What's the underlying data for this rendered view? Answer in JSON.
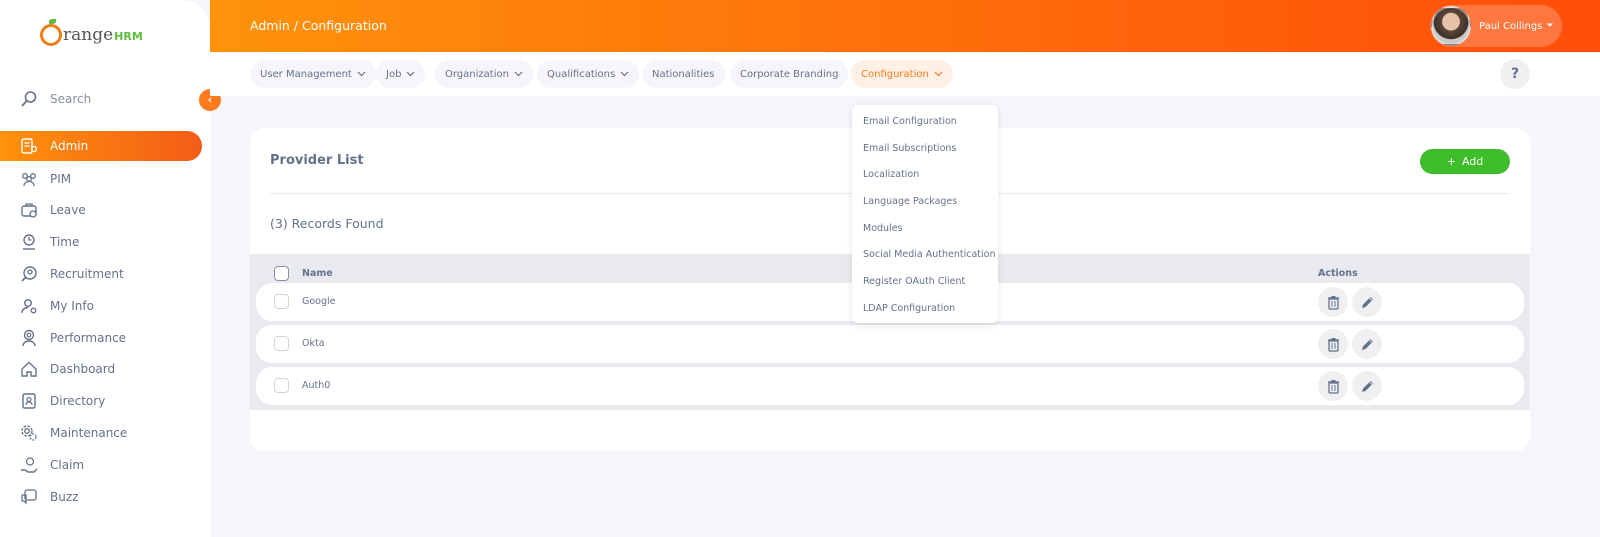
{
  "app": {
    "logo_text": "range",
    "logo_suffix": "HRM"
  },
  "sidebar": {
    "search_label": "Search",
    "collapse_icon": "chevron-left-icon",
    "items": [
      {
        "label": "Admin",
        "icon": "admin-icon",
        "active": true
      },
      {
        "label": "PIM",
        "icon": "pim-icon"
      },
      {
        "label": "Leave",
        "icon": "leave-icon"
      },
      {
        "label": "Time",
        "icon": "time-icon"
      },
      {
        "label": "Recruitment",
        "icon": "recruitment-icon"
      },
      {
        "label": "My Info",
        "icon": "my-info-icon"
      },
      {
        "label": "Performance",
        "icon": "performance-icon"
      },
      {
        "label": "Dashboard",
        "icon": "dashboard-icon"
      },
      {
        "label": "Directory",
        "icon": "directory-icon"
      },
      {
        "label": "Maintenance",
        "icon": "maintenance-icon"
      },
      {
        "label": "Claim",
        "icon": "claim-icon"
      },
      {
        "label": "Buzz",
        "icon": "buzz-icon"
      }
    ]
  },
  "header": {
    "breadcrumb": "Admin / Configuration",
    "user_name": "Paul Collings",
    "caret": "⏷"
  },
  "nav": {
    "tabs": [
      {
        "label": "User Management",
        "has_dropdown": true
      },
      {
        "label": "Job",
        "has_dropdown": true
      },
      {
        "label": "Organization",
        "has_dropdown": true
      },
      {
        "label": "Qualifications",
        "has_dropdown": true
      },
      {
        "label": "Nationalities",
        "has_dropdown": false
      },
      {
        "label": "Corporate Branding",
        "has_dropdown": false
      },
      {
        "label": "Configuration",
        "has_dropdown": true,
        "active": true
      }
    ],
    "help_label": "?"
  },
  "dropdown": {
    "items": [
      "Email Configuration",
      "Email Subscriptions",
      "Localization",
      "Language Packages",
      "Modules",
      "Social Media Authentication",
      "Register OAuth Client",
      "LDAP Configuration"
    ]
  },
  "main": {
    "title": "Provider List",
    "add_label": "Add",
    "add_icon": "plus-icon",
    "records_found": "(3) Records Found",
    "table": {
      "columns": [
        "Name",
        "Actions"
      ],
      "rows": [
        {
          "name": "Google"
        },
        {
          "name": "Okta"
        },
        {
          "name": "Auth0"
        }
      ]
    }
  },
  "colors": {
    "brand_orange": "#ff7b1d",
    "add_green": "#3dbd2a",
    "text": "#64728c"
  }
}
